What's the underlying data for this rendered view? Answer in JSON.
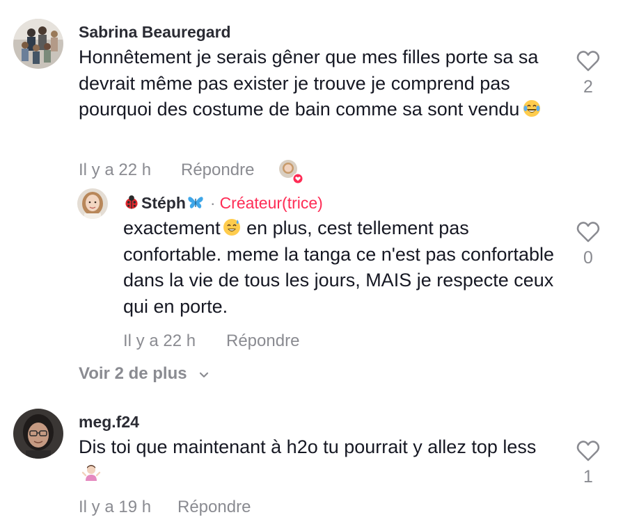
{
  "comments": [
    {
      "username": "Sabrina Beauregard",
      "text": "Honnêtement je serais gêner que mes filles porte sa sa devrait même pas exister je trouve je comprend pas pourquoi des costume de bain comme sa sont vendu",
      "emoji": "laughing-tears-emoji",
      "time": "Il y a 22 h",
      "reply_label": "Répondre",
      "likes": "2",
      "creator_liked": true
    },
    {
      "username": "meg.f24",
      "text": "Dis toi que maintenant à h2o tu pourrait y allez top less",
      "emoji": "person-shrugging-emoji",
      "time": "Il y a 19 h",
      "reply_label": "Répondre",
      "likes": "1"
    }
  ],
  "reply": {
    "username": "Stéph",
    "username_prefix_emoji": "ladybug-emoji",
    "username_suffix_emoji": "butterfly-emoji",
    "separator": "·",
    "creator_badge": "Créateur(trice)",
    "text_before_emoji": "exactement",
    "emoji": "sweat-smile-emoji",
    "text_after_emoji": " en plus, cest tellement pas confortable. meme la tanga ce n'est pas confortable dans la vie de tous les jours, MAIS je respecte ceux qui en porte.",
    "time": "Il y a 22 h",
    "reply_label": "Répondre",
    "likes": "0"
  },
  "more_replies": {
    "label": "Voir 2 de plus",
    "icon": "chevron-down-icon"
  },
  "colors": {
    "text": "#161823",
    "muted": "#8a8b91",
    "creator": "#fe2c55",
    "liked_heart": "#fe2c55"
  }
}
